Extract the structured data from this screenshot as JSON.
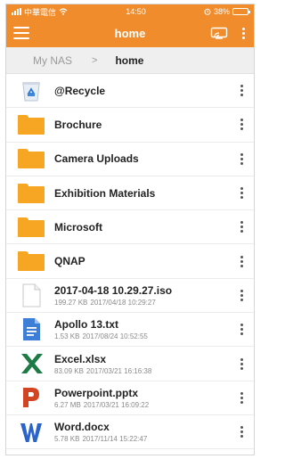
{
  "status_bar": {
    "carrier": "中華電信",
    "time": "14:50",
    "battery": "38%",
    "battery_level": 0.38
  },
  "app_bar": {
    "title": "home",
    "menu_icon": "hamburger-icon",
    "cast_icon": "cast-icon",
    "more_icon": "more-vertical-icon"
  },
  "breadcrumb": {
    "root": "My NAS",
    "separator": ">",
    "current": "home"
  },
  "colors": {
    "accent": "#f08c2c",
    "folder": "#f6a623",
    "txt_blue": "#3d7fd6",
    "excel_green": "#1e7b45",
    "ppt_red": "#d14424",
    "word_blue": "#2a63c9"
  },
  "files": [
    {
      "name": "@Recycle",
      "icon": "recycle-bin-icon",
      "size": "",
      "date": ""
    },
    {
      "name": "Brochure",
      "icon": "folder-icon",
      "size": "",
      "date": ""
    },
    {
      "name": "Camera Uploads",
      "icon": "folder-icon",
      "size": "",
      "date": ""
    },
    {
      "name": "Exhibition Materials",
      "icon": "folder-icon",
      "size": "",
      "date": ""
    },
    {
      "name": "Microsoft",
      "icon": "folder-icon",
      "size": "",
      "date": ""
    },
    {
      "name": "QNAP",
      "icon": "folder-icon",
      "size": "",
      "date": ""
    },
    {
      "name": "2017-04-18 10.29.27.iso",
      "icon": "generic-file-icon",
      "size": "199.27 KB",
      "date": "2017/04/18 10:29:27"
    },
    {
      "name": "Apollo 13.txt",
      "icon": "text-file-icon",
      "size": "1.53 KB",
      "date": "2017/08/24 10:52:55"
    },
    {
      "name": "Excel.xlsx",
      "icon": "excel-icon",
      "size": "83.09 KB",
      "date": "2017/03/21 16:16:38"
    },
    {
      "name": "Powerpoint.pptx",
      "icon": "powerpoint-icon",
      "size": "6.27 MB",
      "date": "2017/03/21 16:09:22"
    },
    {
      "name": "Word.docx",
      "icon": "word-icon",
      "size": "5.78 KB",
      "date": "2017/11/14 15:22:47"
    }
  ]
}
